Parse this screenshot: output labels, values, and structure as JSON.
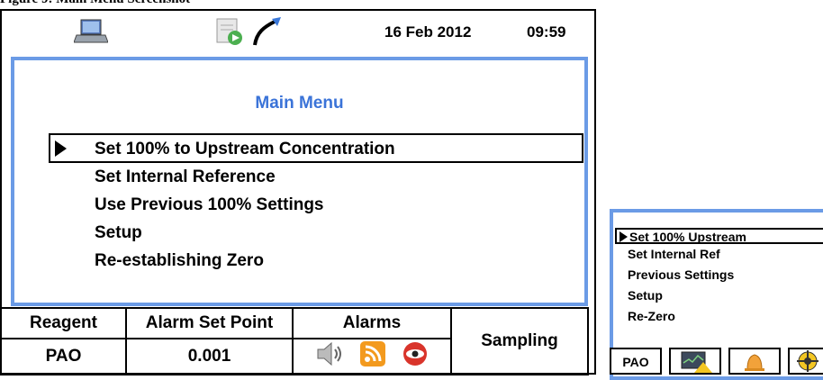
{
  "caption": "Figure 9: Main Menu Screenshot",
  "header": {
    "date": "16 Feb 2012",
    "time": "09:59",
    "icons": [
      "laptop-icon",
      "notepad-icon",
      "probe-icon"
    ]
  },
  "menu": {
    "title": "Main Menu",
    "items": [
      {
        "label": "Set 100% to Upstream Concentration",
        "selected": true
      },
      {
        "label": "Set Internal Reference"
      },
      {
        "label": "Use Previous 100% Settings"
      },
      {
        "label": "Setup"
      },
      {
        "label": "Re-establishing Zero"
      }
    ]
  },
  "status": {
    "reagent_header": "Reagent",
    "alarm_header": "Alarm Set Point",
    "alarms_header": "Alarms",
    "reagent_value": "PAO",
    "alarm_value": "0.001",
    "mode": "Sampling",
    "alarm_icons": [
      "speaker-icon",
      "rss-icon",
      "eye-icon"
    ]
  },
  "small_display": {
    "items": [
      {
        "label": "Set 100% Upstream",
        "selected": true
      },
      {
        "label": "Set Internal Ref"
      },
      {
        "label": "Previous Settings"
      },
      {
        "label": "Setup"
      },
      {
        "label": "Re-Zero"
      }
    ],
    "reagent": "PAO",
    "icons": [
      "monitor-icon",
      "bell-icon",
      "target-icon"
    ]
  },
  "colors": {
    "accent": "#6b9be6",
    "title": "#3a73d8",
    "border": "#000000"
  }
}
